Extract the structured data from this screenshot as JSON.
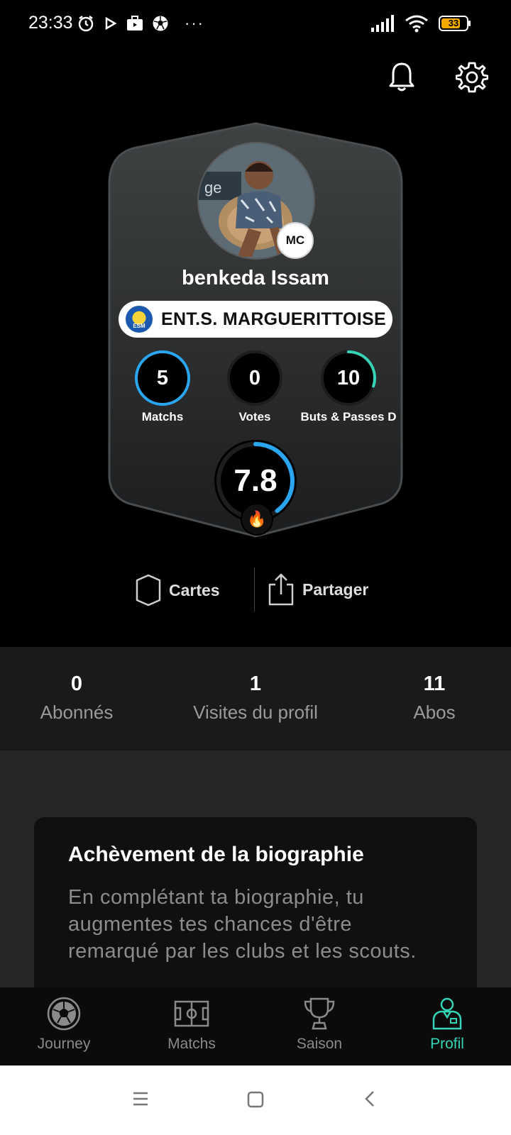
{
  "status_bar": {
    "time": "23:33",
    "battery": "33",
    "icons": [
      "alarm-icon",
      "play-icon",
      "briefcase-icon",
      "soccer-ball-icon",
      "more-icon",
      "signal-icon",
      "wifi-icon",
      "battery-icon"
    ],
    "more": "···"
  },
  "header": {
    "icons": [
      "bell-icon",
      "gear-icon"
    ]
  },
  "player_card": {
    "position_badge": "MC",
    "name": "benkeda Issam",
    "club": "ENT.S. MARGUERITTOISE",
    "club_logo_text": "ESM",
    "stats": [
      {
        "label": "Matchs",
        "value": "5",
        "progress": 1.0
      },
      {
        "label": "Votes",
        "value": "0",
        "progress": 0.0
      },
      {
        "label": "Buts & Passes D",
        "value": "10",
        "progress": 0.3
      }
    ],
    "rating": {
      "value": "7.8",
      "progress": 0.4,
      "badge": "🔥"
    },
    "colors": {
      "ring_blue": "#2aa6f0",
      "ring_teal": "#35d3b7",
      "card_top": "#3a3d3e",
      "card_bottom": "#1e1f20"
    }
  },
  "actions": {
    "cards_label": "Cartes",
    "share_label": "Partager"
  },
  "social": [
    {
      "count": "0",
      "label": "Abonnés"
    },
    {
      "count": "1",
      "label": "Visites du profil"
    },
    {
      "count": "11",
      "label": "Abos"
    }
  ],
  "biography": {
    "title": "Achèvement de la biographie",
    "text": "En complétant ta biographie, tu augmentes tes chances d'être remarqué par les clubs et les scouts."
  },
  "bottom_nav": {
    "items": [
      {
        "label": "Journey",
        "icon": "soccer-ball-icon",
        "active": false
      },
      {
        "label": "Matchs",
        "icon": "pitch-icon",
        "active": false
      },
      {
        "label": "Saison",
        "icon": "trophy-icon",
        "active": false
      },
      {
        "label": "Profil",
        "icon": "player-icon",
        "active": true
      }
    ],
    "active_color": "#35d3b7"
  },
  "system_nav": {
    "icons": [
      "menu-icon",
      "home-icon",
      "back-icon"
    ]
  }
}
